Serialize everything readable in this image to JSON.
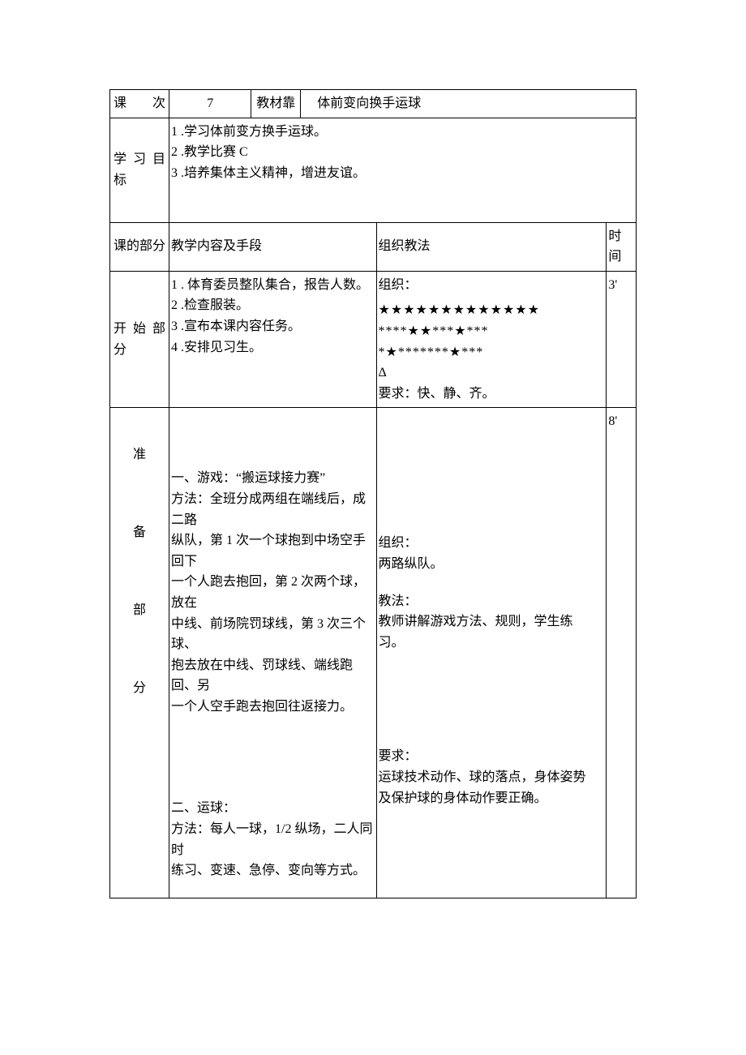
{
  "row1": {
    "label1": "课次",
    "value1": "7",
    "label2": "教材靠",
    "value2": "体前变向换手运球"
  },
  "row2": {
    "label": "学 习 目标",
    "item1": "1 .学习体前变方换手运球。",
    "item2": "2 .教学比赛 C",
    "item3": "3 .培养集体主义精神，增进友谊。"
  },
  "row3": {
    "label1": "课的部分",
    "label2": "教学内容及手段",
    "label3": "组织教法",
    "label4": "时间"
  },
  "start": {
    "label": "开 始 部分",
    "item1": "1 . 体育委员整队集合，报告人数。",
    "item2": "2 .检查服装。",
    "item3": "3 .宣布本课内容任务。",
    "item4": "4 .安排见习生。",
    "org_label": "组织：",
    "stars1": "★★★★★★★★★★★★★",
    "stars2": "****★★***★***",
    "stars3": "*★*******★***",
    "tri": "Δ",
    "req": "要求：快、静、齐。",
    "time": "3'"
  },
  "prep": {
    "label1": "准",
    "label2": "备",
    "label3": "部",
    "label4": "分",
    "game_title": "一、游戏：“搬运球接力赛”",
    "game_line1": "方法：全班分成两组在端线后，成二路",
    "game_line2": "纵队，第 1 次一个球抱到中场空手回下",
    "game_line3": "一个人跑去抱回，第 2 次两个球，放在",
    "game_line4": "中线、前场院罚球线，第 3 次三个球、",
    "game_line5": "抱去放在中线、罚球线、端线跑回、另",
    "game_line6": "一个人空手跑去抱回往返接力。",
    "dribble_title": "二、运球：",
    "dribble_line1": "方法：每人一球，1/2 纵场，二人同时",
    "dribble_line2": "练习、变速、急停、变向等方式。",
    "org_label": "组织：",
    "org_line": "两路纵队。",
    "method_label": "教法：",
    "method_line1": "教师讲解游戏方法、规则，学生练",
    "method_line2": "习。",
    "req_label": "要求：",
    "req_line1": "运球技术动作、球的落点，身体姿势",
    "req_line2": "及保护球的身体动作要正确。",
    "time": "8'"
  }
}
